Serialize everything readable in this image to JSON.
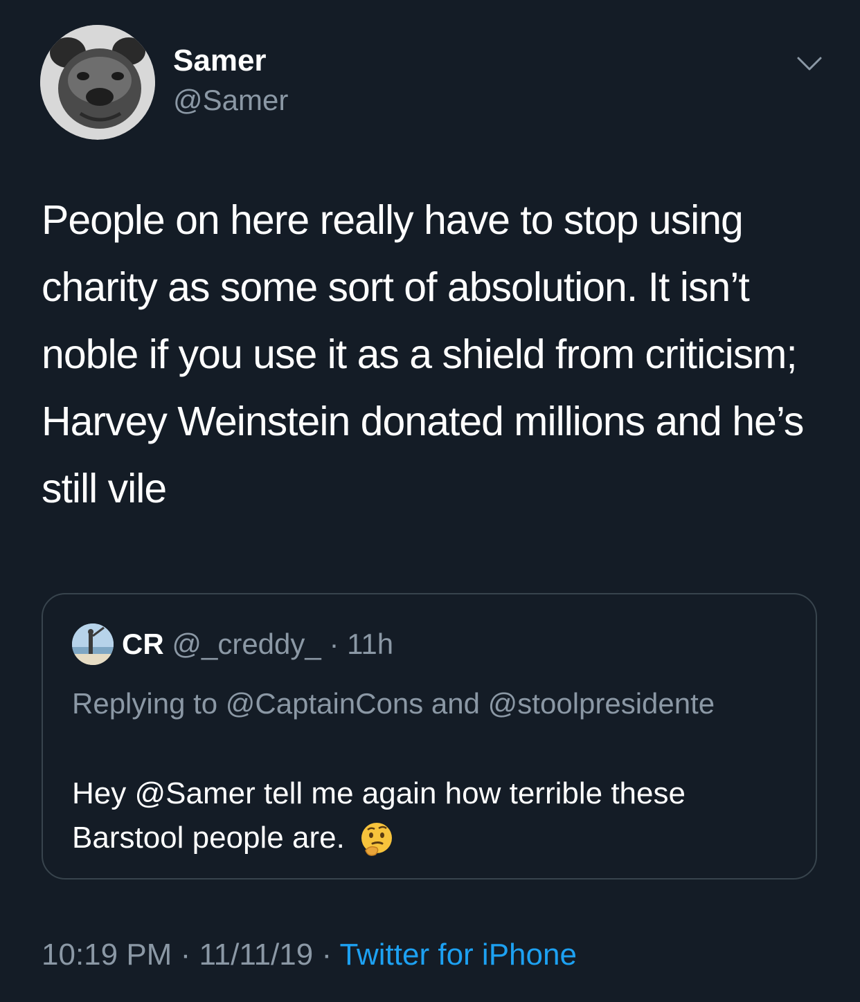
{
  "author": {
    "display_name": "Samer",
    "handle": "@Samer",
    "avatar_icon": "pug-avatar"
  },
  "tweet": {
    "text": "People on here really have to stop using charity as some sort of absolution. It isn’t noble if you use it as a shield from criticism; Harvey Weinstein donated millions and he’s still vile"
  },
  "quoted_tweet": {
    "display_name": "CR",
    "handle": "@_creddy_",
    "separator": "·",
    "time_ago": "11h",
    "replying_prefix": "Replying to",
    "replying_to_1": "@CaptainCons",
    "replying_and": "and",
    "replying_to_2": "@stoolpresidente",
    "body": "Hey @Samer tell me again how terrible these Barstool people are.",
    "emoji_icon": "thinking-face-emoji"
  },
  "footer": {
    "time": "10:19 PM",
    "separator": "·",
    "date": "11/11/19",
    "source": "Twitter for iPhone"
  },
  "colors": {
    "background": "#141c26",
    "text_primary": "#ffffff",
    "text_secondary": "#8b98a5",
    "link": "#1da1f2",
    "border": "#38444d"
  }
}
